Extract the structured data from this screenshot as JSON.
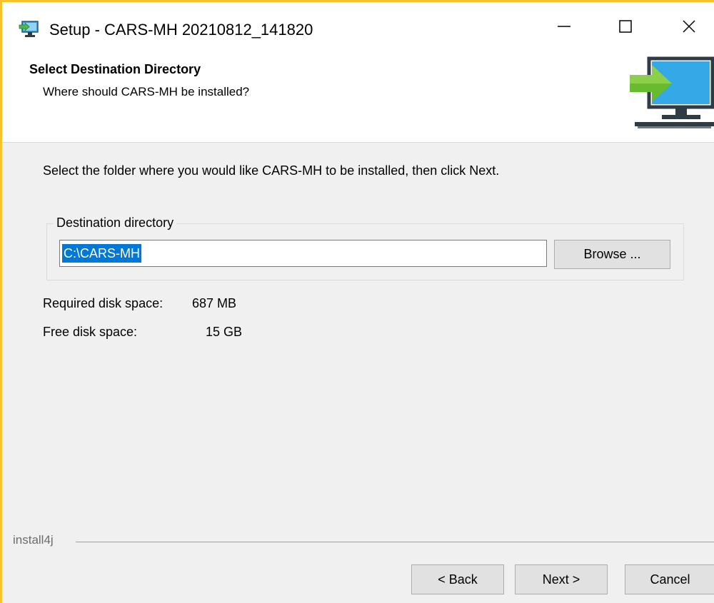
{
  "window": {
    "title": "Setup - CARS-MH 20210812_141820",
    "accent_border": "#f3c42b"
  },
  "titlebar_icons": {
    "app": "installer-monitor-icon",
    "minimize": "minimize-icon",
    "maximize": "maximize-icon",
    "close": "close-icon"
  },
  "header": {
    "title": "Select Destination Directory",
    "subtitle": "Where should CARS-MH be installed?",
    "icon": "monitor-arrow-icon"
  },
  "main": {
    "instructions": "Select the folder where you would like CARS-MH to be installed, then click Next.",
    "group_label": "Destination directory",
    "dir_value": "C:\\CARS-MH",
    "browse_label": "Browse ...",
    "required_label": "Required disk space:",
    "required_value": "687 MB",
    "free_label": "Free disk space:",
    "free_value": "15 GB"
  },
  "footer": {
    "brand": "install4j",
    "back_label": "< Back",
    "next_label": "Next >",
    "cancel_label": "Cancel"
  }
}
